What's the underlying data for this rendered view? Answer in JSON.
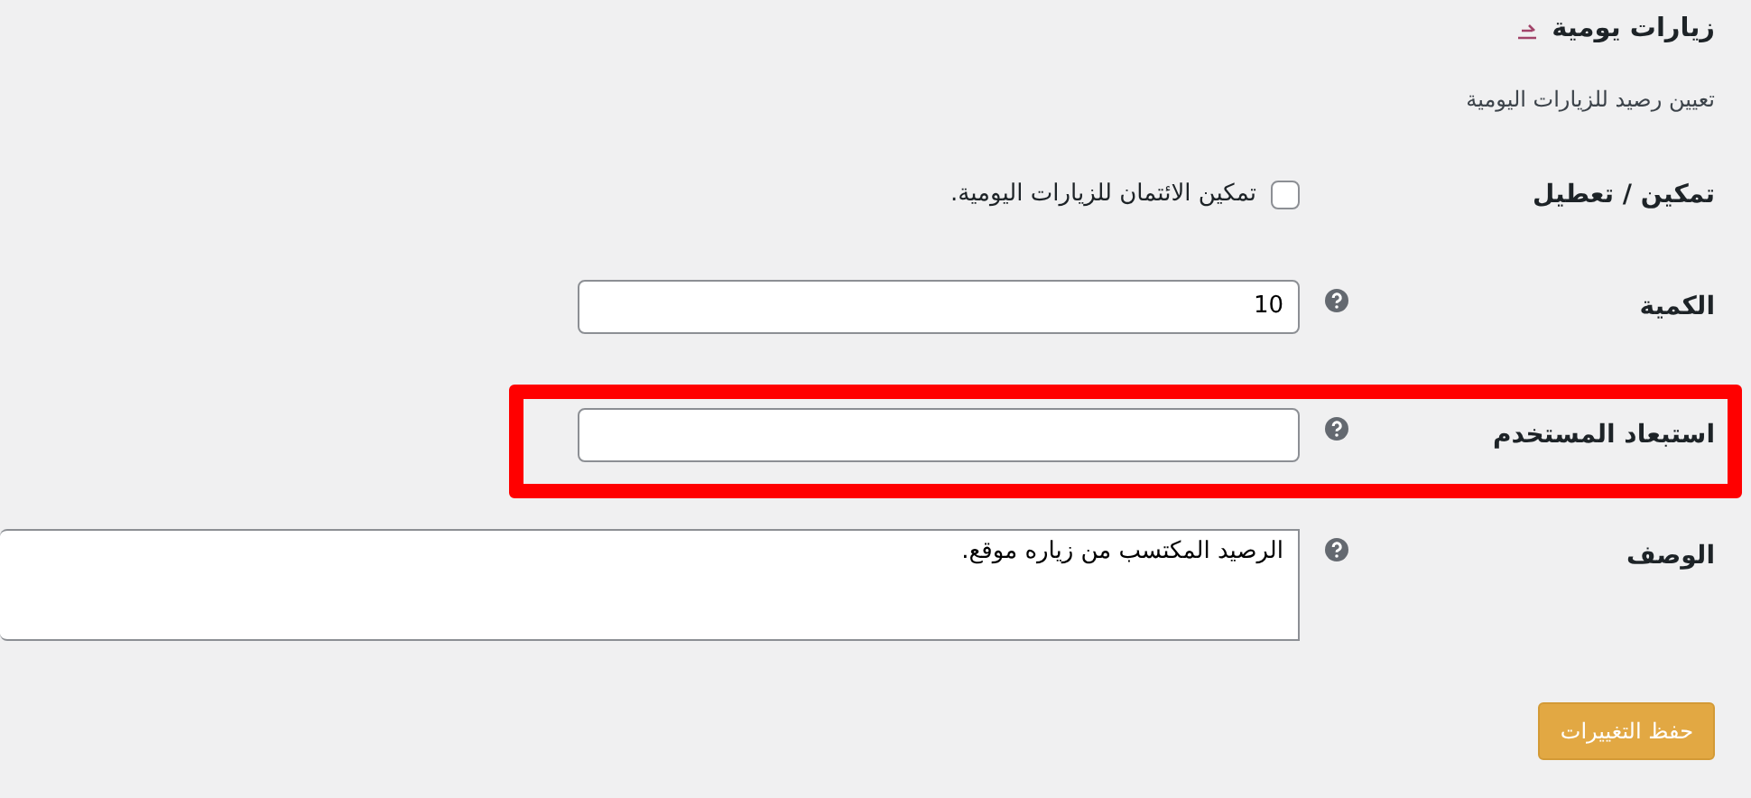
{
  "section": {
    "title": "زيارات يومية",
    "description": "تعيين رصيد للزيارات اليومية"
  },
  "fields": [
    {
      "kind": "checkbox",
      "label": "تمكين / تعطيل",
      "help": false,
      "checked": false,
      "text": "تمكين الائتمان للزيارات اليومية.",
      "highlighted": false
    },
    {
      "kind": "input",
      "label": "الكمية",
      "help": true,
      "value": "10",
      "highlighted": false
    },
    {
      "kind": "input",
      "label": "استبعاد المستخدم",
      "help": true,
      "highlighted": true
    },
    {
      "kind": "textarea",
      "label": "الوصف",
      "help": true,
      "value": "الرصيد المكتسب من زياره موقع.",
      "highlighted": false
    }
  ],
  "save_button": "حفظ التغييرات"
}
